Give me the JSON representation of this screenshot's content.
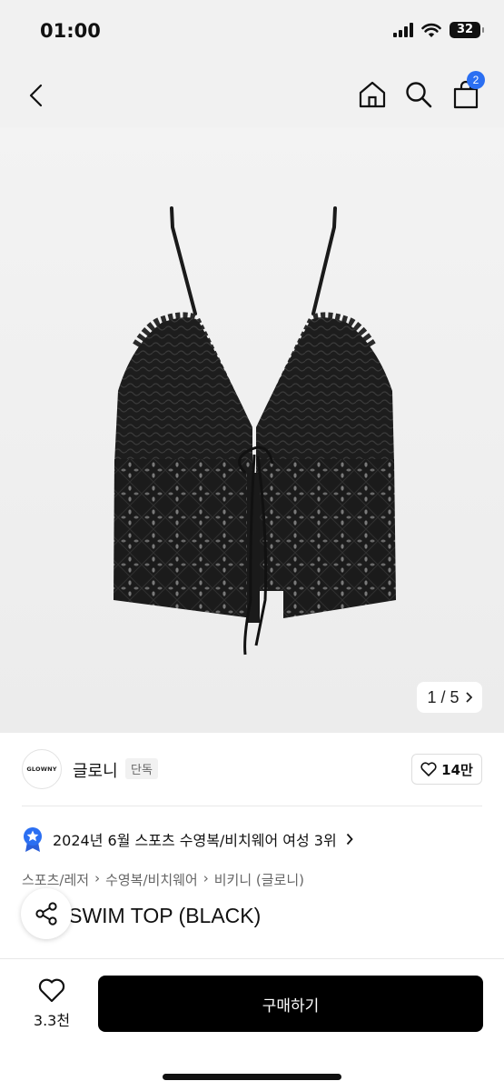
{
  "status_bar": {
    "time": "01:00",
    "battery": "32"
  },
  "header": {
    "cart_count": "2"
  },
  "gallery": {
    "page_indicator": "1 / 5"
  },
  "brand": {
    "logo_text": "GLOWNY",
    "name": "글로니",
    "tag": "단독",
    "likes": "14만"
  },
  "ranking": {
    "text": "2024년 6월 스포츠 수영복/비치웨어 여성 3위"
  },
  "breadcrumbs": [
    "스포츠/레저",
    "수영복/비치웨어",
    "비키니 (글로니)"
  ],
  "product": {
    "title": "KINI SWIM TOP (BLACK)"
  },
  "bottom": {
    "wishlist_count": "3.3천",
    "buy_label": "구매하기"
  },
  "colors": {
    "accent": "#2b6ff2",
    "buy_button": "#000000",
    "background": "#f1f1f1"
  }
}
